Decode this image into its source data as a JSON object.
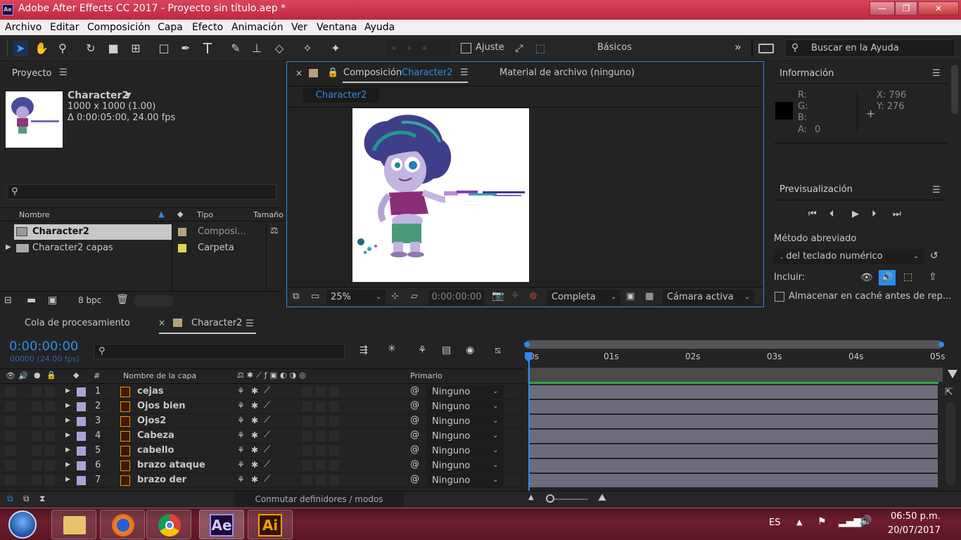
{
  "window": {
    "title": "Adobe After Effects CC 2017 - Proyecto sin título.aep *",
    "logo": "Ae",
    "min": "—",
    "max": "❐",
    "close": "✕"
  },
  "menu": [
    "Archivo",
    "Editar",
    "Composición",
    "Capa",
    "Efecto",
    "Animación",
    "Ver",
    "Ventana",
    "Ayuda"
  ],
  "toolbar": {
    "ajuste": "Ajuste",
    "workspace": "Básicos",
    "help_placeholder": "Buscar en la Ayuda",
    "more": "»"
  },
  "project": {
    "title": "Proyecto",
    "name": "Character2",
    "dims": "1000 x 1000 (1.00)",
    "duration": "Δ 0:00:05:00, 24.00 fps",
    "columns": {
      "name": "Nombre",
      "type": "Tipo",
      "size": "Tamaño"
    },
    "items": [
      {
        "name": "Character2",
        "type": "Composi...",
        "color": "#b4a27a"
      },
      {
        "name": "Character2 capas",
        "type": "Carpeta",
        "color": "#e5d44e"
      }
    ],
    "bpc": "8 bpc"
  },
  "composition": {
    "tab_prefix": "Composición",
    "tab_name": "Character2",
    "footage_tab": "Material de archivo",
    "footage_value": "(ninguno)",
    "subtab": "Character2",
    "zoom": "25%",
    "timecode": "0:00:00:00",
    "resolution": "Completa",
    "camera": "Cámara activa"
  },
  "info": {
    "title": "Información",
    "r": "R:",
    "g": "G:",
    "b": "B:",
    "a": "A:",
    "a_val": "0",
    "x": "X: 796",
    "y": "Y: 276"
  },
  "preview": {
    "title": "Previsualización",
    "shortcut_label": "Método abreviado",
    "shortcut_value": ". del teclado numérico",
    "include": "Incluir:",
    "cache": "Almacenar en caché antes de rep..."
  },
  "timeline": {
    "tab_queue": "Cola de procesamiento",
    "tab_comp": "Character2",
    "time": "0:00:00:00",
    "frames": "00000 (24.00 fps)",
    "col_num": "#",
    "col_name": "Nombre de la capa",
    "col_parent": "Primario",
    "ruler": [
      "0s",
      "01s",
      "02s",
      "03s",
      "04s",
      "05s"
    ],
    "layers": [
      {
        "num": "1",
        "name": "cejas",
        "parent": "Ninguno",
        "visible": true
      },
      {
        "num": "2",
        "name": "Ojos bien",
        "parent": "Ninguno",
        "visible": false
      },
      {
        "num": "3",
        "name": "Ojos2",
        "parent": "Ninguno",
        "visible": true
      },
      {
        "num": "4",
        "name": "Cabeza",
        "parent": "Ninguno",
        "visible": true
      },
      {
        "num": "5",
        "name": "cabello",
        "parent": "Ninguno",
        "visible": true
      },
      {
        "num": "6",
        "name": "brazo ataque",
        "parent": "Ninguno",
        "visible": true
      },
      {
        "num": "7",
        "name": "brazo der",
        "parent": "Ninguno",
        "visible": false
      }
    ],
    "footer": "Conmutar definidores / modos"
  },
  "taskbar": {
    "lang": "ES",
    "time": "06:50 p.m.",
    "date": "20/07/2017",
    "ae": "Ae",
    "ai": "Ai"
  },
  "colors": {
    "accent": "#2d8ceb",
    "titlebar": "#c7314a",
    "layer_label": "#a9a4d8",
    "track": "#6d6c7d"
  }
}
